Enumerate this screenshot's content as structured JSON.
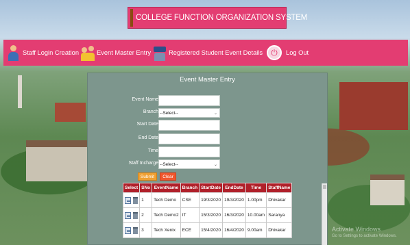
{
  "app": {
    "title": "COLLEGE FUNCTION ORGANIZATION SYSTEM"
  },
  "nav": {
    "items": [
      {
        "label": "Staff Login Creation",
        "icon": "staff-person-icon"
      },
      {
        "label": "Event Master Entry",
        "icon": "people-group-icon"
      },
      {
        "label": "Registered Student Event Details",
        "icon": "students-icon"
      },
      {
        "label": "Log Out",
        "icon": "power-icon"
      }
    ]
  },
  "form": {
    "heading": "Event Master Entry",
    "fields": {
      "event_name": {
        "label": "Event Name",
        "value": ""
      },
      "branch": {
        "label": "Branch",
        "selected": "--Select--"
      },
      "start_date": {
        "label": "Start Date",
        "value": ""
      },
      "end_date": {
        "label": "End Date",
        "value": ""
      },
      "time": {
        "label": "Time",
        "value": ""
      },
      "staff_incharge": {
        "label": "Staff Incharge",
        "selected": "--Select--"
      }
    },
    "submit_label": "Submit",
    "clear_label": "Clear"
  },
  "table": {
    "headers": [
      "Select",
      "SNo",
      "EventName",
      "Branch",
      "StartDate",
      "EndDate",
      "Time",
      "StaffName"
    ],
    "rows": [
      {
        "sno": "1",
        "event": "Tech Demo",
        "branch": "CSE",
        "start": "19/3/2020",
        "end": "19/3/2020",
        "time": "1.00pm",
        "staff": "Dhivakar"
      },
      {
        "sno": "2",
        "event": "Tech Demo2",
        "branch": "IT",
        "start": "15/3/2020",
        "end": "16/3/2020",
        "time": "10.00am",
        "staff": "Saranya"
      },
      {
        "sno": "3",
        "event": "Tech Xenix",
        "branch": "ECE",
        "start": "15/4/2020",
        "end": "16/4/2020",
        "time": "9.00am",
        "staff": "Dhivakar"
      }
    ]
  },
  "watermark": {
    "line1": "Activate Windows",
    "line2": "Go to Settings to activate Windows."
  },
  "colors": {
    "banner": "#e33d72",
    "panel": "#7d968d",
    "table_header": "#b0202a",
    "submit": "#f0a032",
    "clear": "#f0562d"
  }
}
